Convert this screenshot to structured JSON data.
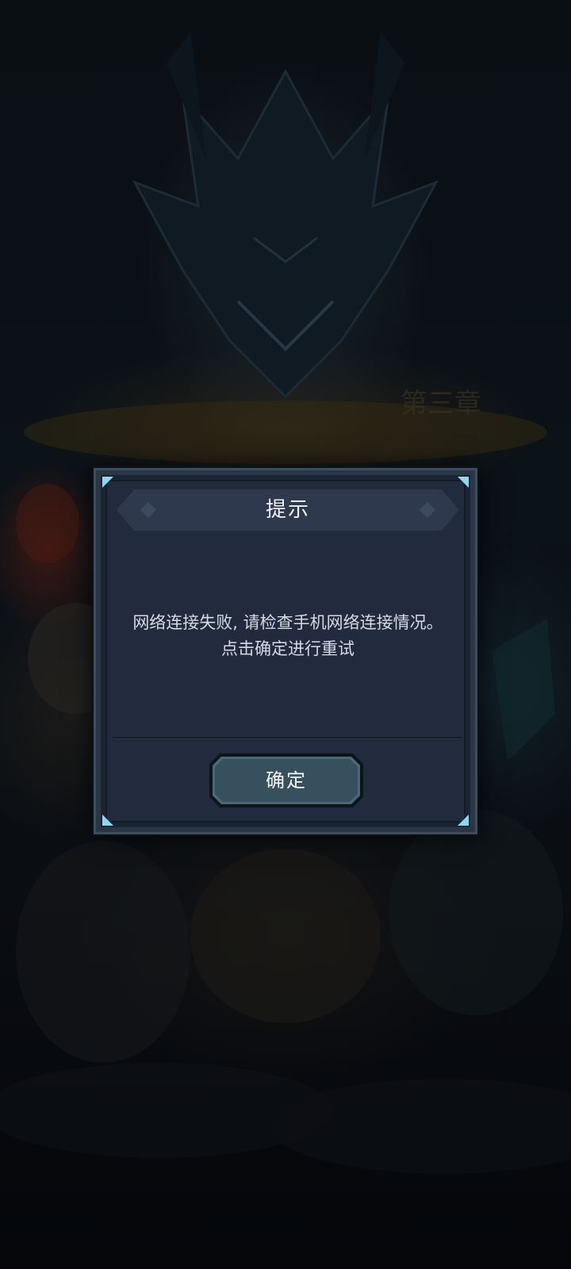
{
  "dialog": {
    "title": "提示",
    "message_line1": "网络连接失败, 请检查手机网络连接情况。",
    "message_line2": "点击确定进行重试",
    "confirm_label": "确定"
  },
  "colors": {
    "dialog_bg": "#222a3e",
    "dialog_frame": "#3c4d5e",
    "corner_accent": "#8fd6f0",
    "button_fill": "#3a5564"
  }
}
